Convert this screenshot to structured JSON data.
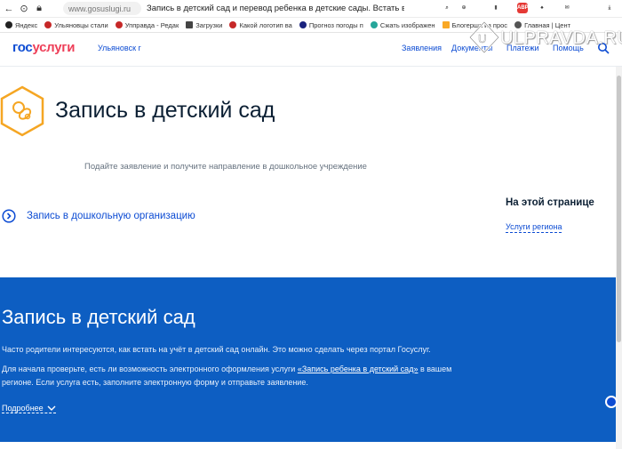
{
  "browser": {
    "url": "www.gosuslugi.ru",
    "tab_title": "Запись в детский сад и перевод ребенка в детские сады. Встать в...",
    "bookmarks": [
      {
        "label": "Яндекс",
        "color": "#222"
      },
      {
        "label": "Ульяновцы стали",
        "color": "#c62828"
      },
      {
        "label": "Упправда - Редак",
        "color": "#c62828"
      },
      {
        "label": "Загрузки",
        "color": "#444"
      },
      {
        "label": "Какой логотип ва",
        "color": "#c62828"
      },
      {
        "label": "Прогноз погоды п",
        "color": "#1a237e"
      },
      {
        "label": "Сжать изображен",
        "color": "#26a69a"
      },
      {
        "label": "Блогерша из прос",
        "color": "#f9a825"
      },
      {
        "label": "Главная | Цент",
        "color": "#555"
      }
    ]
  },
  "watermark": {
    "text": "ULPRAVDA.RU"
  },
  "header": {
    "logo_part1": "гос",
    "logo_part2": "услуги",
    "city": "Ульяновск г",
    "nav": [
      "Заявления",
      "Документы",
      "Платежи",
      "Помощь"
    ]
  },
  "page": {
    "title": "Запись в детский сад",
    "lead": "Подайте заявление и получите направление в дошкольное учреждение",
    "action": "Запись в дошкольную организацию",
    "aside_title": "На этой странице",
    "aside_link": "Услуги региона"
  },
  "info": {
    "title": "Запись в детский сад",
    "p1": "Часто родители интересуются, как встать на учёт в детский сад онлайн. Это можно сделать через портал Госуслуг.",
    "p2_start": "Для начала проверьте, есть ли возможность электронного оформления услуги ",
    "p2_link": "«Запись ребенка в детский сад»",
    "p2_end": " в вашем регионе. Если услуга есть, заполните электронную форму и отправьте заявление.",
    "more": "Подробнее"
  },
  "colors": {
    "brand_blue": "#0d4cd3",
    "brand_red": "#ee3f58",
    "accent_orange": "#f5a623",
    "info_bg": "#0d5ec2"
  }
}
